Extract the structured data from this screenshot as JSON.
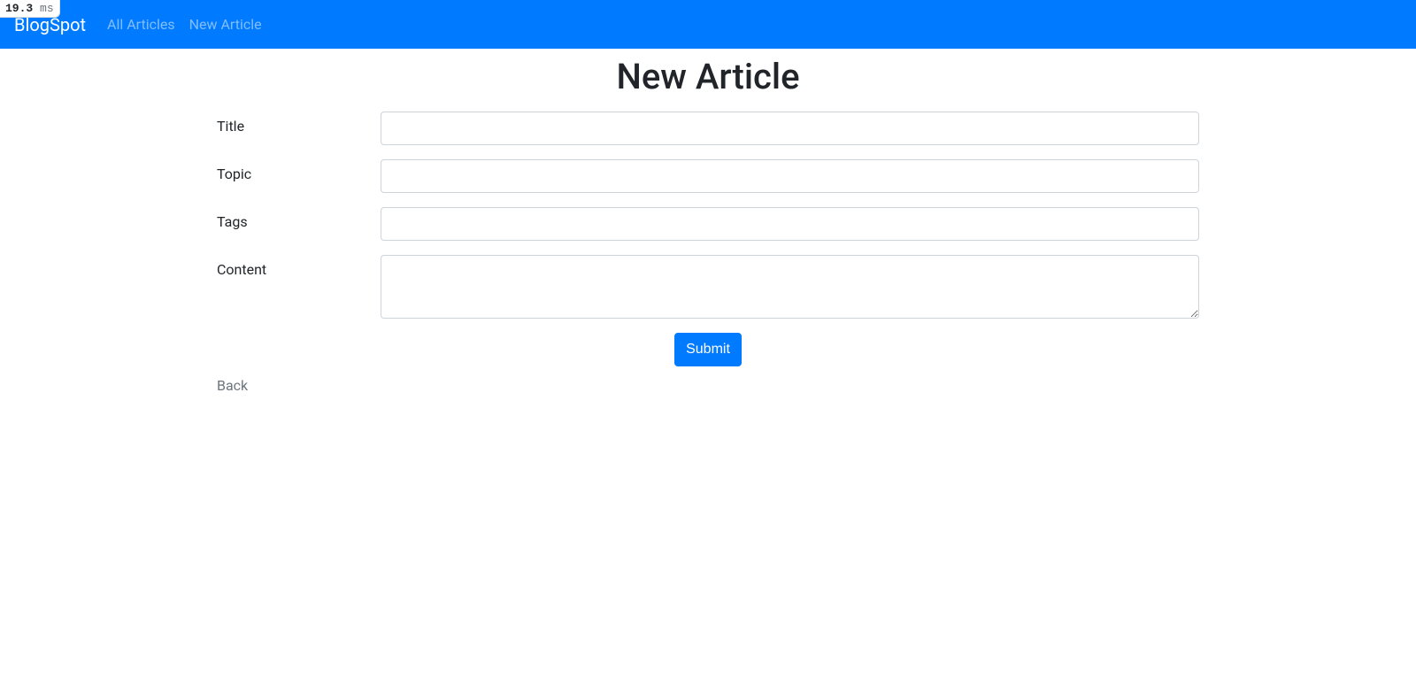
{
  "perf": {
    "value": "19.3",
    "unit": "ms"
  },
  "navbar": {
    "brand": "BlogSpot",
    "links": [
      {
        "label": "All Articles"
      },
      {
        "label": "New Article"
      }
    ]
  },
  "page": {
    "title": "New Article"
  },
  "form": {
    "fields": {
      "title": {
        "label": "Title",
        "value": ""
      },
      "topic": {
        "label": "Topic",
        "value": ""
      },
      "tags": {
        "label": "Tags",
        "value": ""
      },
      "content": {
        "label": "Content",
        "value": ""
      }
    },
    "submit_label": "Submit"
  },
  "back_label": "Back"
}
